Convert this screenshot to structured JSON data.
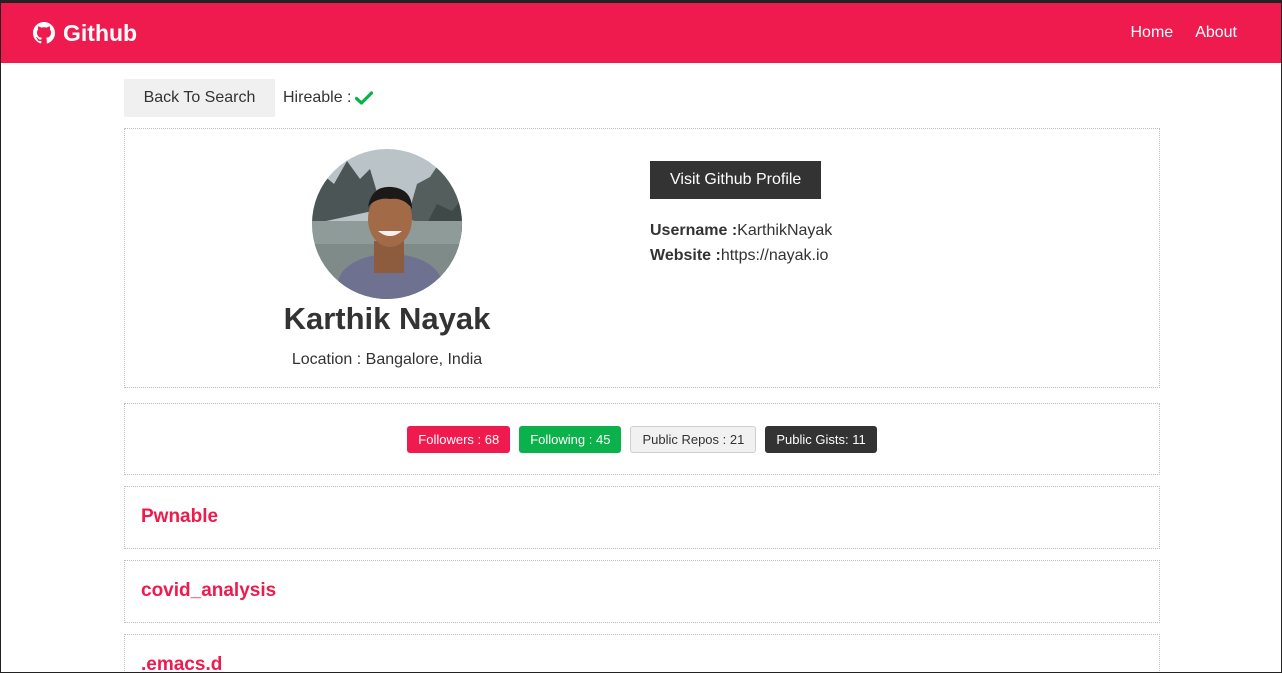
{
  "navbar": {
    "brand": "Github",
    "brand_icon": "github-icon",
    "links": [
      {
        "label": "Home"
      },
      {
        "label": "About"
      }
    ],
    "color": "#ef1a4d"
  },
  "toolbar": {
    "back_label": "Back To Search",
    "hireable_label": "Hireable :",
    "hireable_icon": "check-icon"
  },
  "profile": {
    "name": "Karthik Nayak",
    "location": "Location : Bangalore, India",
    "visit_label": "Visit Github Profile",
    "username_label": "Username :",
    "username": "KarthikNayak",
    "website_label": "Website :",
    "website": "https://nayak.io"
  },
  "stats": {
    "followers": "Followers : 68",
    "following": "Following : 45",
    "public_repos": "Public Repos : 21",
    "public_gists": "Public Gists: 11"
  },
  "repos": [
    {
      "name": "Pwnable"
    },
    {
      "name": "covid_analysis"
    },
    {
      "name": ".emacs.d"
    }
  ]
}
